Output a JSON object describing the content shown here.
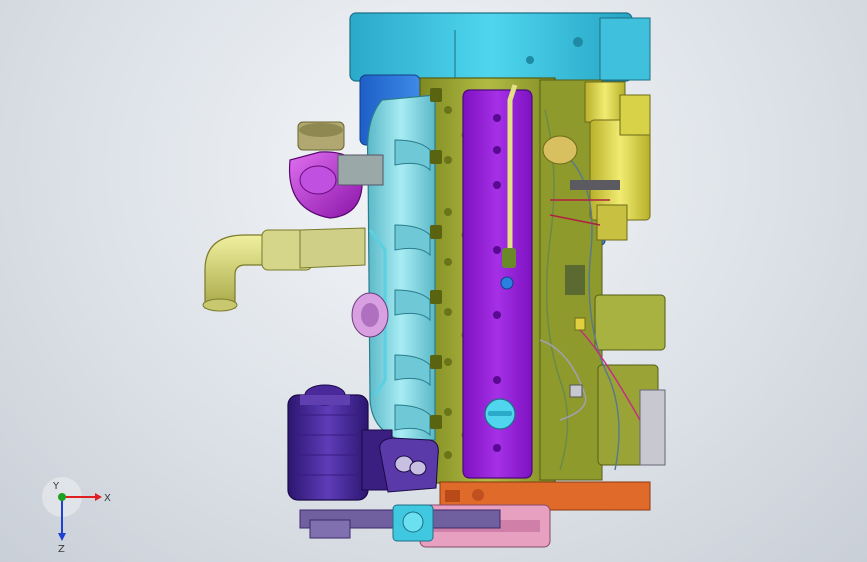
{
  "viewport": {
    "background_top": "#f4f6f8",
    "background_bottom": "#c9cfd7"
  },
  "triad": {
    "x_label": "X",
    "y_label": "Y",
    "z_label": "Z",
    "x_color": "#e02020",
    "y_color": "#20a020",
    "z_color": "#2040d0"
  },
  "model": {
    "block_color": "#aab43a",
    "cover_color": "#9a1fd6",
    "flywheel_housing_color": "#3fd0e8",
    "manifold_color": "#7fd6e6",
    "turbo_color": "#c030d8",
    "starter_color": "#e8e050",
    "pump_color": "#4a2a9a",
    "oilpan_color": "#e06a2a",
    "pulley_color": "#e8a0c0"
  }
}
